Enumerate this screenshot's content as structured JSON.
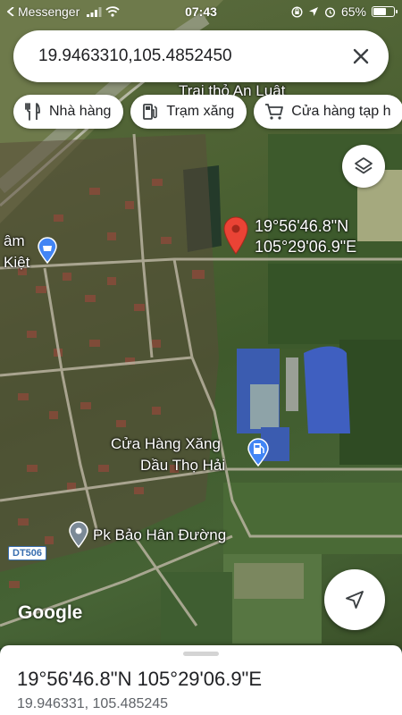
{
  "status_bar": {
    "back_app": "Messenger",
    "time": "07:43",
    "battery": "65%",
    "battery_level": 0.65
  },
  "search": {
    "query": "19.9463310,105.4852450"
  },
  "chips": [
    {
      "label": "Nhà hàng",
      "icon": "restaurant-icon"
    },
    {
      "label": "Trạm xăng",
      "icon": "gas-station-icon"
    },
    {
      "label": "Cửa hàng tạp h",
      "icon": "shopping-cart-icon"
    }
  ],
  "map": {
    "dropped_pin": {
      "lat": "19°56'46.8\"N",
      "lng": "105°29'06.9\"E"
    },
    "labels": {
      "farm": "Trại thỏ An Luật",
      "place_left_line1": "âm",
      "place_left_line2": "Kiệt",
      "gas_station_line1": "Cửa Hàng Xăng",
      "gas_station_line2": "Dầu Thọ Hải",
      "clinic": "Pk Bảo Hân Đường",
      "road": "DT506"
    },
    "attribution": "Google",
    "colors": {
      "pin": "#ea4335",
      "poi_blue": "#4285f4",
      "poi_gray": "#7b8a97"
    }
  },
  "sheet": {
    "title": "19°56'46.8\"N 105°29'06.9\"E",
    "subtitle": "19.946331, 105.485245"
  }
}
